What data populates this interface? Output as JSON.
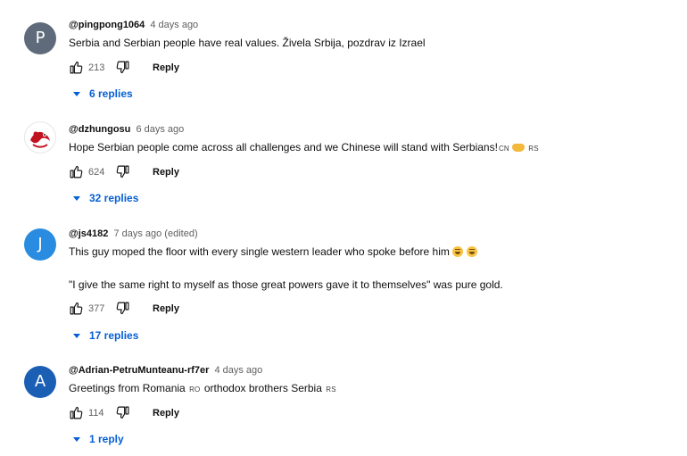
{
  "comments": [
    {
      "avatar_letter": "P",
      "avatar_color": "#5f6b7a",
      "author": "@pingpong1064",
      "time": "4 days ago",
      "text": "Serbia and Serbian people have real values. Živela Srbija, pozdrav iz Izrael",
      "likes": "213",
      "reply_label": "Reply",
      "replies": "6 replies"
    },
    {
      "avatar_icon": "dragon-logo",
      "author": "@dzhungosu",
      "time": "6 days ago",
      "text": "Hope Serbian people come across all challenges and we Chinese will stand with Serbians!",
      "flag_1": "CN",
      "flag_2": "RS",
      "likes": "624",
      "reply_label": "Reply",
      "replies": "32 replies"
    },
    {
      "avatar_letter": "J",
      "avatar_color": "#2a8ce0",
      "author": "@js4182",
      "time": "7 days ago (edited)",
      "text_1": "This guy moped the floor with every single western leader who spoke before him",
      "text_2": "\"I give the same right to myself as those great powers gave it to themselves\" was pure gold.",
      "likes": "377",
      "reply_label": "Reply",
      "replies": "17 replies"
    },
    {
      "avatar_letter": "A",
      "avatar_color": "#1a5fb4",
      "author": "@Adrian-PetruMunteanu-rf7er",
      "time": "4 days ago",
      "text_a": "Greetings from Romania",
      "flag_1": "RO",
      "text_b": "orthodox brothers Serbia",
      "flag_2": "RS",
      "likes": "114",
      "reply_label": "Reply",
      "replies": "1 reply"
    }
  ],
  "icons": {
    "like": "thumbs-up-icon",
    "dislike": "thumbs-down-icon",
    "caret": "caret-down-icon"
  },
  "colors": {
    "link_blue": "#065fd4",
    "secondary_text": "#606060"
  }
}
